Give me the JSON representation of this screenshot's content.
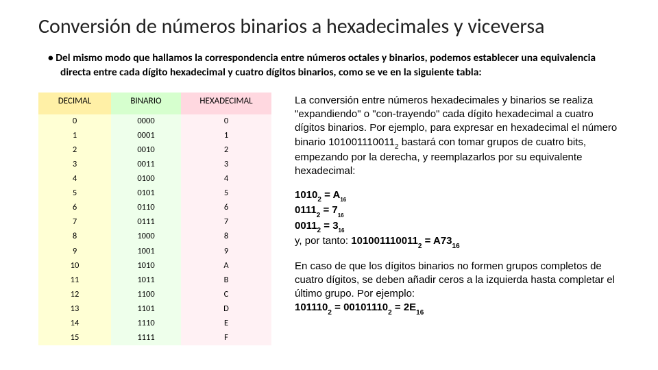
{
  "title": "Conversión de números binarios a hexadecimales y viceversa",
  "bullet": "Del mismo modo que hallamos la correspondencia entre números octales y binarios, podemos establecer una equivalencia directa entre cada dígito hexadecimal y cuatro dígitos binarios, como se ve en la siguiente tabla:",
  "table": {
    "head": {
      "dec": "DECIMAL",
      "bin": "BINARIO",
      "hex": "HEXADECIMAL"
    },
    "rows": [
      {
        "dec": "0",
        "bin": "0000",
        "hex": "0"
      },
      {
        "dec": "1",
        "bin": "0001",
        "hex": "1"
      },
      {
        "dec": "2",
        "bin": "0010",
        "hex": "2"
      },
      {
        "dec": "3",
        "bin": "0011",
        "hex": "3"
      },
      {
        "dec": "4",
        "bin": "0100",
        "hex": "4"
      },
      {
        "dec": "5",
        "bin": "0101",
        "hex": "5"
      },
      {
        "dec": "6",
        "bin": "0110",
        "hex": "6"
      },
      {
        "dec": "7",
        "bin": "0111",
        "hex": "7"
      },
      {
        "dec": "8",
        "bin": "1000",
        "hex": "8"
      },
      {
        "dec": "9",
        "bin": "1001",
        "hex": "9"
      },
      {
        "dec": "10",
        "bin": "1010",
        "hex": "A"
      },
      {
        "dec": "11",
        "bin": "1011",
        "hex": "B"
      },
      {
        "dec": "12",
        "bin": "1100",
        "hex": "C"
      },
      {
        "dec": "13",
        "bin": "1101",
        "hex": "D"
      },
      {
        "dec": "14",
        "bin": "1110",
        "hex": "E"
      },
      {
        "dec": "15",
        "bin": "1111",
        "hex": "F"
      }
    ]
  },
  "right": {
    "p1a": "La conversión entre números hexadecimales y binarios se realiza \"expandiendo\" o \"con-trayendo\" cada dígito hexadecimal a cuatro dígitos binarios. Por ejemplo, para expresar en hexadecimal el número binario 101001110011",
    "p1a_sub": "2",
    "p1b": " bastará con tomar grupos de cuatro bits, empezando por la derecha, y reemplazarlos por su equivalente hexadecimal:",
    "eq1_a": "1010",
    "eq1_a_sub": "2",
    "eq1_a_eq": " = A",
    "eq1_a_rsub": "16",
    "eq1_b": "0111",
    "eq1_b_sub": "2",
    "eq1_b_eq": " = 7",
    "eq1_b_rsub": "16",
    "eq1_c": "0011",
    "eq1_c_sub": "2",
    "eq1_c_eq": " = 3",
    "eq1_c_rsub": "16",
    "eq1_d_pre": "y, por tanto: ",
    "eq1_d": "101001110011",
    "eq1_d_sub": "2",
    "eq1_d_eq": " = A73",
    "eq1_d_rsub": "16",
    "p2": "En caso de que los dígitos binarios no formen grupos completos de cuatro dígitos, se deben añadir ceros a la izquierda hasta completar el último grupo. Por ejemplo:",
    "eq2_a": "101110",
    "eq2_a_sub": "2",
    "eq2_b_eq": " = 00101110",
    "eq2_b_sub": "2",
    "eq2_c_eq": " = 2E",
    "eq2_c_sub": "16"
  }
}
